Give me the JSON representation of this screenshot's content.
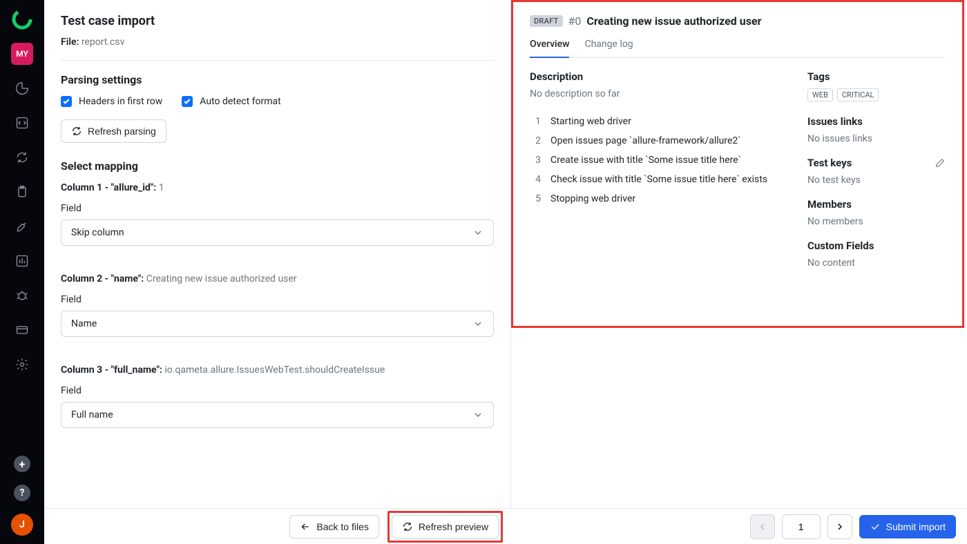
{
  "sidebar": {
    "workspace_badge": "MY",
    "user_initial": "J"
  },
  "header": {
    "title": "Test case import",
    "file_label": "File:",
    "file_value": "report.csv"
  },
  "parsing": {
    "title": "Parsing settings",
    "headers_cb": "Headers in first row",
    "autodetect_cb": "Auto detect format",
    "refresh_btn": "Refresh parsing"
  },
  "mapping": {
    "title": "Select mapping",
    "field_label": "Field",
    "columns": [
      {
        "label": "Column 1 - \"allure_id\":",
        "sample": "1",
        "selected": "Skip column"
      },
      {
        "label": "Column 2 - \"name\":",
        "sample": "Creating new issue authorized user",
        "selected": "Name"
      },
      {
        "label": "Column 3 - \"full_name\":",
        "sample": "io.qameta.allure.IssuesWebTest.shouldCreateIssue",
        "selected": "Full name"
      }
    ]
  },
  "footer": {
    "back_btn": "Back to files",
    "refresh_preview_btn": "Refresh preview",
    "page": "1",
    "submit_btn": "Submit import"
  },
  "preview": {
    "draft_badge": "DRAFT",
    "issue_id": "#0",
    "issue_title": "Creating new issue authorized user",
    "tabs": {
      "overview": "Overview",
      "changelog": "Change log"
    },
    "description": {
      "heading": "Description",
      "text": "No description so far"
    },
    "steps": [
      "Starting web driver",
      "Open issues page `allure-framework/allure2`",
      "Create issue with title `Some issue title here`",
      "Check issue with title `Some issue title here` exists",
      "Stopping web driver"
    ],
    "tags": {
      "heading": "Tags",
      "items": [
        "WEB",
        "CRITICAL"
      ]
    },
    "issues_links": {
      "heading": "Issues links",
      "text": "No issues links"
    },
    "test_keys": {
      "heading": "Test keys",
      "text": "No test keys"
    },
    "members": {
      "heading": "Members",
      "text": "No members"
    },
    "custom_fields": {
      "heading": "Custom Fields",
      "text": "No content"
    }
  }
}
